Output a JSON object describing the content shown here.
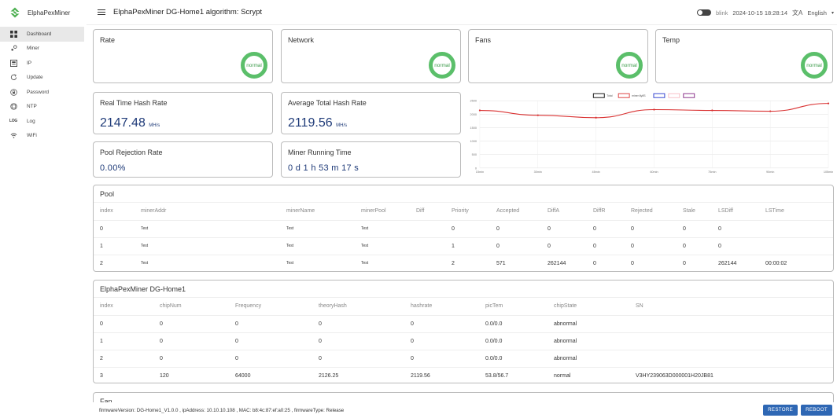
{
  "brand": "ElphaPexMiner",
  "nav": [
    {
      "label": "Dashboard",
      "icon": "dashboard-icon",
      "active": true
    },
    {
      "label": "Miner",
      "icon": "miner-icon"
    },
    {
      "label": "IP",
      "icon": "ip-icon"
    },
    {
      "label": "Update",
      "icon": "update-icon"
    },
    {
      "label": "Password",
      "icon": "password-icon"
    },
    {
      "label": "NTP",
      "icon": "ntp-icon"
    },
    {
      "label": "Log",
      "icon": "log-icon",
      "glyph": "LOG"
    },
    {
      "label": "WiFi",
      "icon": "wifi-icon"
    }
  ],
  "header": {
    "title": "ElphaPexMiner DG-Home1 algorithm: Scrypt",
    "blink": "blink",
    "datetime": "2024-10-15 18:28:14",
    "language": "English"
  },
  "status_cards": [
    {
      "title": "Rate",
      "status": "normal"
    },
    {
      "title": "Network",
      "status": "normal"
    },
    {
      "title": "Fans",
      "status": "normal"
    },
    {
      "title": "Temp",
      "status": "normal"
    }
  ],
  "stats": {
    "realtime_label": "Real Time Hash Rate",
    "realtime_value": "2147.48",
    "realtime_unit": "MH/s",
    "average_label": "Average Total Hash Rate",
    "average_value": "2119.56",
    "average_unit": "MH/s",
    "rejection_label": "Pool Rejection Rate",
    "rejection_value": "0.00%",
    "runtime_label": "Miner Running Time",
    "runtime_value": "0 d 1 h 53 m 17 s"
  },
  "chart_data": {
    "type": "line",
    "legend": [
      "Total",
      "miner:8y8S"
    ],
    "legend_placement": "top-center",
    "x": [
      "15min",
      "30min",
      "45min",
      "60min",
      "75min",
      "90min",
      "105min"
    ],
    "y_ticks": [
      0,
      500,
      1000,
      1500,
      2000,
      2500
    ],
    "ylim": [
      0,
      2500
    ],
    "grid": true,
    "series": [
      {
        "name": "miner:8y8S",
        "color": "#d93030",
        "values": [
          2140,
          1960,
          1870,
          2170,
          2140,
          2110,
          2400
        ]
      }
    ]
  },
  "pool": {
    "title": "Pool",
    "columns": [
      "index",
      "minerAddr",
      "minerName",
      "minerPool",
      "Diff",
      "Priority",
      "Accepted",
      "DiffA",
      "DiffR",
      "Rejected",
      "Stale",
      "LSDiff",
      "LSTime"
    ],
    "rows": [
      [
        "0",
        "Test",
        "Test",
        "Test",
        "",
        "0",
        "0",
        "0",
        "0",
        "0",
        "0",
        "0",
        ""
      ],
      [
        "1",
        "Test",
        "Test",
        "Test",
        "",
        "1",
        "0",
        "0",
        "0",
        "0",
        "0",
        "0",
        ""
      ],
      [
        "2",
        "Test",
        "Test",
        "Test",
        "",
        "2",
        "571",
        "262144",
        "0",
        "0",
        "0",
        "262144",
        "00:00:02"
      ]
    ]
  },
  "miner": {
    "title": "ElphaPexMiner DG-Home1",
    "columns": [
      "index",
      "chipNum",
      "Frequency",
      "theoryHash",
      "hashrate",
      "picTem",
      "chipState",
      "SN"
    ],
    "rows": [
      [
        "0",
        "0",
        "0",
        "0",
        "0",
        "0.0/0.0",
        "abnormal",
        ""
      ],
      [
        "1",
        "0",
        "0",
        "0",
        "0",
        "0.0/0.0",
        "abnormal",
        ""
      ],
      [
        "2",
        "0",
        "0",
        "0",
        "0",
        "0.0/0.0",
        "abnormal",
        ""
      ],
      [
        "3",
        "120",
        "64000",
        "2126.25",
        "2119.56",
        "53.8/56.7",
        "normal",
        "V3HY239063D000001H20JB81"
      ]
    ]
  },
  "fan": {
    "title": "Fan"
  },
  "footer": {
    "info": "firmwareVersion: DG-Home1_V1.0.0 , ipAddress: 10.10.10.108 , MAC: b8:4c:87:ef:a0:25 , firmwareType: Release",
    "restore": "RESTORE",
    "reboot": "REBOOT"
  },
  "colors": {
    "accent": "#2e67b4",
    "ok": "#5bbf6a",
    "value": "#1e3a78",
    "line": "#d93030"
  }
}
